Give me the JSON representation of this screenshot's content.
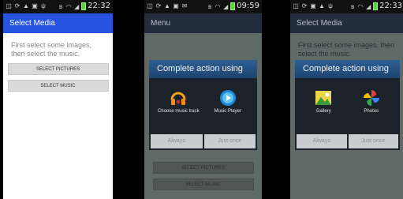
{
  "screens": [
    {
      "time": "22:32",
      "title": "Select Media",
      "hint": "First select some images, then select the music.",
      "buttons": [
        "SELECT PICTURES",
        "SELECT MUSIC"
      ]
    },
    {
      "time": "09:59",
      "title": "Menu",
      "dialog": {
        "title": "Complete action using",
        "apps": [
          "Choose music track",
          "Music Player"
        ],
        "buttons": [
          "Always",
          "Just once"
        ]
      },
      "buttons": [
        "SELECT PICTURES",
        "SELECT MUSIC"
      ]
    },
    {
      "time": "22:33",
      "title": "Select Media",
      "hint": "First select some images, then select the music.",
      "dialog": {
        "title": "Complete action using",
        "apps": [
          "Gallery",
          "Photos"
        ],
        "buttons": [
          "Always",
          "Just once"
        ]
      }
    }
  ]
}
